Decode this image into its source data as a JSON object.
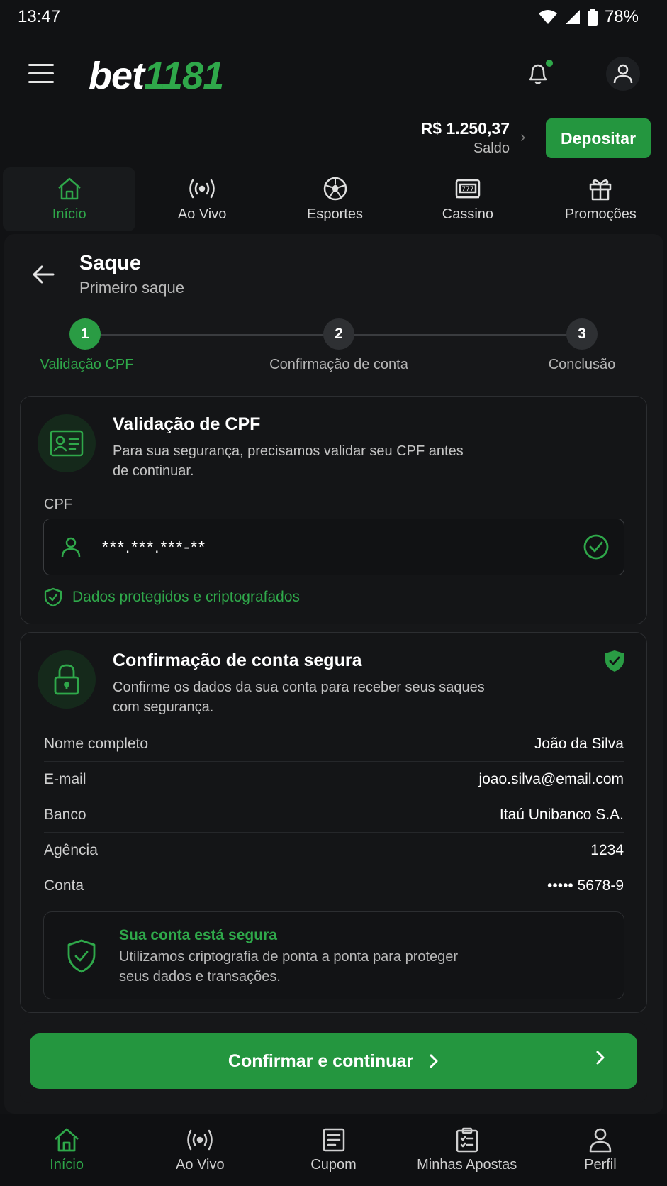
{
  "status": {
    "time": "13:47",
    "battery": "78%"
  },
  "header": {
    "logo_text": "bet",
    "logo_number": "1181",
    "balance_amount": "R$ 1.250,37",
    "balance_label": "Saldo",
    "deposit_label": "Depositar"
  },
  "topnav": [
    {
      "label": "Início",
      "icon": "home-icon"
    },
    {
      "label": "Ao Vivo",
      "icon": "live-icon"
    },
    {
      "label": "Esportes",
      "icon": "soccer-ball-icon"
    },
    {
      "label": "Cassino",
      "icon": "slot-machine-icon"
    },
    {
      "label": "Promoções",
      "icon": "gift-icon"
    }
  ],
  "page": {
    "title": "Saque",
    "subtitle": "Primeiro saque"
  },
  "stepper": [
    {
      "number": "1",
      "label": "Validação CPF"
    },
    {
      "number": "2",
      "label": "Confirmação de conta"
    },
    {
      "number": "3",
      "label": "Conclusão"
    }
  ],
  "cpf_card": {
    "title": "Validação de CPF",
    "description": "Para sua segurança, precisamos validar seu CPF antes de continuar.",
    "field_label": "CPF",
    "field_value": "***.***.***-**",
    "protected_text": "Dados protegidos e criptografados"
  },
  "account_card": {
    "title": "Confirmação de conta segura",
    "description": "Confirme os dados da sua conta para receber seus saques com segurança.",
    "rows": [
      {
        "key": "Nome completo",
        "value": "João da Silva"
      },
      {
        "key": "E-mail",
        "value": "joao.silva@email.com"
      },
      {
        "key": "Banco",
        "value": "Itaú Unibanco S.A."
      },
      {
        "key": "Agência",
        "value": "1234"
      },
      {
        "key": "Conta",
        "value": "••••• 5678-9"
      }
    ],
    "secure_title": "Sua conta está segura",
    "secure_desc": "Utilizamos criptografia de ponta a ponta para proteger seus dados e transações."
  },
  "cta": {
    "label": "Confirmar e continuar"
  },
  "bottomnav": [
    {
      "label": "Início",
      "icon": "home-icon"
    },
    {
      "label": "Ao Vivo",
      "icon": "live-icon"
    },
    {
      "label": "Cupom",
      "icon": "coupon-icon"
    },
    {
      "label": "Minhas Apostas",
      "icon": "clipboard-icon"
    },
    {
      "label": "Perfil",
      "icon": "user-icon"
    }
  ],
  "colors": {
    "accent": "#24963f",
    "accent_text": "#2fa84a",
    "background": "#111214"
  }
}
